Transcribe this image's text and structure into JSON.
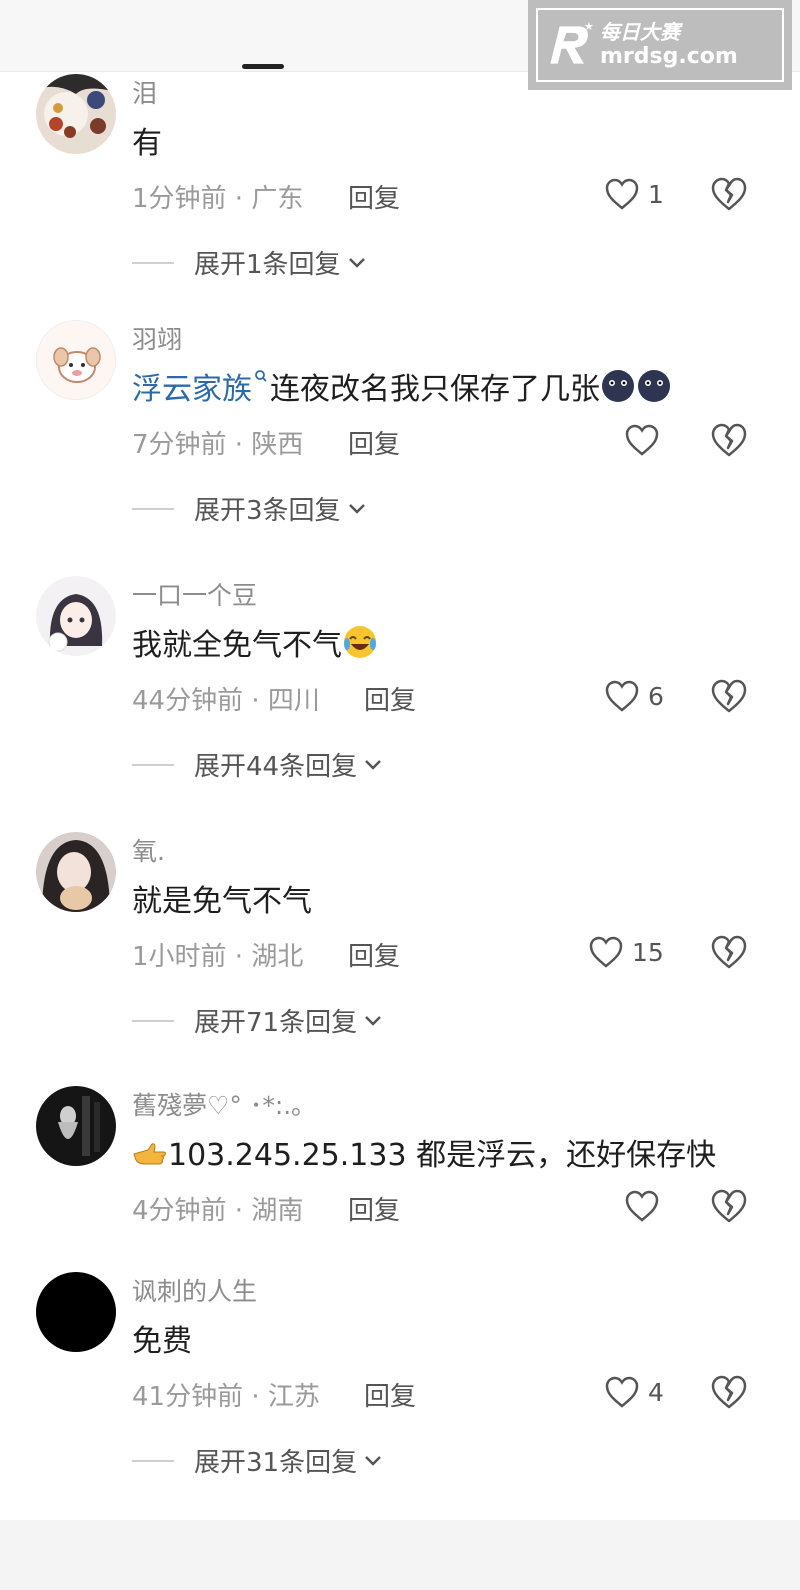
{
  "watermark": {
    "brand": "每日大赛",
    "url": "mrdsg.com"
  },
  "comments": [
    {
      "name": "泪",
      "text": "有",
      "time_loc": "1分钟前 · 广东",
      "reply": "回复",
      "likes": "1",
      "expand": "展开1条回复"
    },
    {
      "name": "羽翊",
      "mention": "浮云家族",
      "text": "连夜改名我只保存了几张",
      "time_loc": "7分钟前 · 陕西",
      "reply": "回复",
      "likes": "",
      "expand": "展开3条回复"
    },
    {
      "name": "一口一个豆",
      "text": "我就全免气不气",
      "time_loc": "44分钟前 · 四川",
      "reply": "回复",
      "likes": "6",
      "expand": "展开44条回复"
    },
    {
      "name": "氧.",
      "text": "就是免气不气",
      "time_loc": "1小时前 · 湖北",
      "reply": "回复",
      "likes": "15",
      "expand": "展开71条回复"
    },
    {
      "name": "舊殘夢♡° ･*:.｡",
      "text": "103.245.25.133 都是浮云，还好保存快",
      "time_loc": "4分钟前 · 湖南",
      "reply": "回复",
      "likes": "",
      "expand": ""
    },
    {
      "name": "讽刺的人生",
      "text": "免费",
      "time_loc": "41分钟前 · 江苏",
      "reply": "回复",
      "likes": "4",
      "expand": "展开31条回复"
    }
  ],
  "colors": {
    "mention": "#2b6aa8",
    "meta": "#9a9a9a",
    "name": "#8c8c8c"
  }
}
